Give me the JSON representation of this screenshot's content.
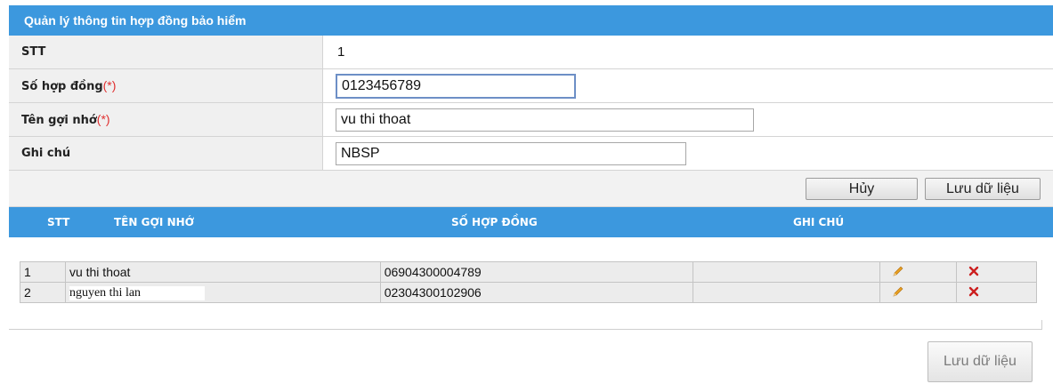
{
  "header": {
    "title": "Quản lý thông tin hợp đồng bảo hiểm"
  },
  "form": {
    "stt_label": "STT",
    "stt_value": "1",
    "contract_no_label": "Số hợp đồng",
    "contract_no_value": "0123456789",
    "nickname_label": "Tên gợi nhớ",
    "nickname_value": "vu thi thoat",
    "note_label": "Ghi chú",
    "note_value": "NBSP",
    "required_mark": "(*)"
  },
  "actions": {
    "cancel_label": "Hủy",
    "save_label": "Lưu dữ liệu"
  },
  "table": {
    "headers": [
      "STT",
      "TÊN GỢI NHỚ",
      "SỐ HỢP ĐỒNG",
      "GHI CHÚ"
    ],
    "rows": [
      {
        "stt": "1",
        "name": "vu thi thoat",
        "contract_no": "06904300004789",
        "note": ""
      },
      {
        "stt": "2",
        "name": "nguyen thi lan",
        "contract_no": "02304300102906",
        "note": ""
      }
    ]
  },
  "footer": {
    "save_label": "Lưu dữ liệu"
  },
  "colors": {
    "header_bg": "#3c98de",
    "required": "#e03030",
    "delete_icon": "#cc1f1f",
    "edit_icon": "#e8a020"
  },
  "icons": {
    "edit": "pencil-icon",
    "delete": "delete-x-icon"
  }
}
